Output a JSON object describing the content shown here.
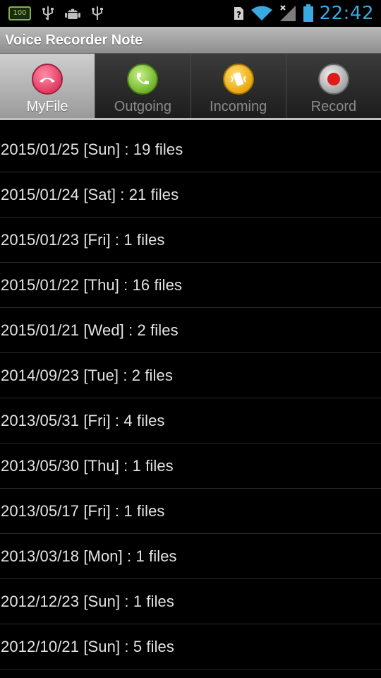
{
  "status_bar": {
    "battery_notification": "100",
    "time": "22:42"
  },
  "app": {
    "title": "Voice Recorder Note"
  },
  "tabs": [
    {
      "label": "MyFile",
      "active": true,
      "icon": "phone-hangup-icon",
      "color": "#e84a6f"
    },
    {
      "label": "Outgoing",
      "active": false,
      "icon": "phone-outgoing-icon",
      "color": "#7cc133"
    },
    {
      "label": "Incoming",
      "active": false,
      "icon": "phone-vibrate-icon",
      "color": "#f0b81c"
    },
    {
      "label": "Record",
      "active": false,
      "icon": "record-dot-icon",
      "color": "#e01b1b"
    }
  ],
  "file_groups": [
    {
      "label": "2015/01/25 [Sun] : 19 files"
    },
    {
      "label": "2015/01/24 [Sat] : 21 files"
    },
    {
      "label": "2015/01/23 [Fri] : 1 files"
    },
    {
      "label": "2015/01/22 [Thu] : 16 files"
    },
    {
      "label": "2015/01/21 [Wed] : 2 files"
    },
    {
      "label": "2014/09/23 [Tue] : 2 files"
    },
    {
      "label": "2013/05/31 [Fri] : 4 files"
    },
    {
      "label": "2013/05/30 [Thu] : 1 files"
    },
    {
      "label": "2013/05/17 [Fri] : 1 files"
    },
    {
      "label": "2013/03/18 [Mon] : 1 files"
    },
    {
      "label": "2012/12/23 [Sun] : 1 files"
    },
    {
      "label": "2012/10/21 [Sun] : 5 files"
    }
  ]
}
